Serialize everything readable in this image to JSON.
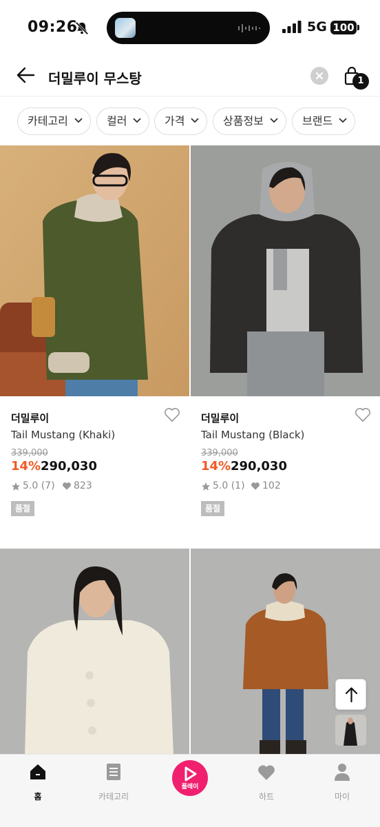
{
  "status_bar": {
    "time": "09:26",
    "network": "5G",
    "battery": "100"
  },
  "search": {
    "query": "더밀루이 무스탕",
    "cart_count": "1"
  },
  "filters": [
    {
      "label": "카테고리"
    },
    {
      "label": "컬러"
    },
    {
      "label": "가격"
    },
    {
      "label": "상품정보"
    },
    {
      "label": "브랜드"
    }
  ],
  "products": [
    {
      "brand": "더밀루이",
      "name": "Tail Mustang (Khaki)",
      "original_price": "339,000",
      "discount": "14%",
      "price": "290,030",
      "rating": "5.0 (7)",
      "likes": "823",
      "badge": "품절"
    },
    {
      "brand": "더밀루이",
      "name": "Tail Mustang (Black)",
      "original_price": "339,000",
      "discount": "14%",
      "price": "290,030",
      "rating": "5.0 (1)",
      "likes": "102",
      "badge": "품절"
    }
  ],
  "bottom_nav": {
    "home": "홈",
    "category": "카테고리",
    "play": "플레이",
    "heart": "하트",
    "my": "마이"
  },
  "colors": {
    "discount": "#f15a24",
    "play_accent": "#f0206e",
    "soldout_badge": "#bdbdbd"
  }
}
